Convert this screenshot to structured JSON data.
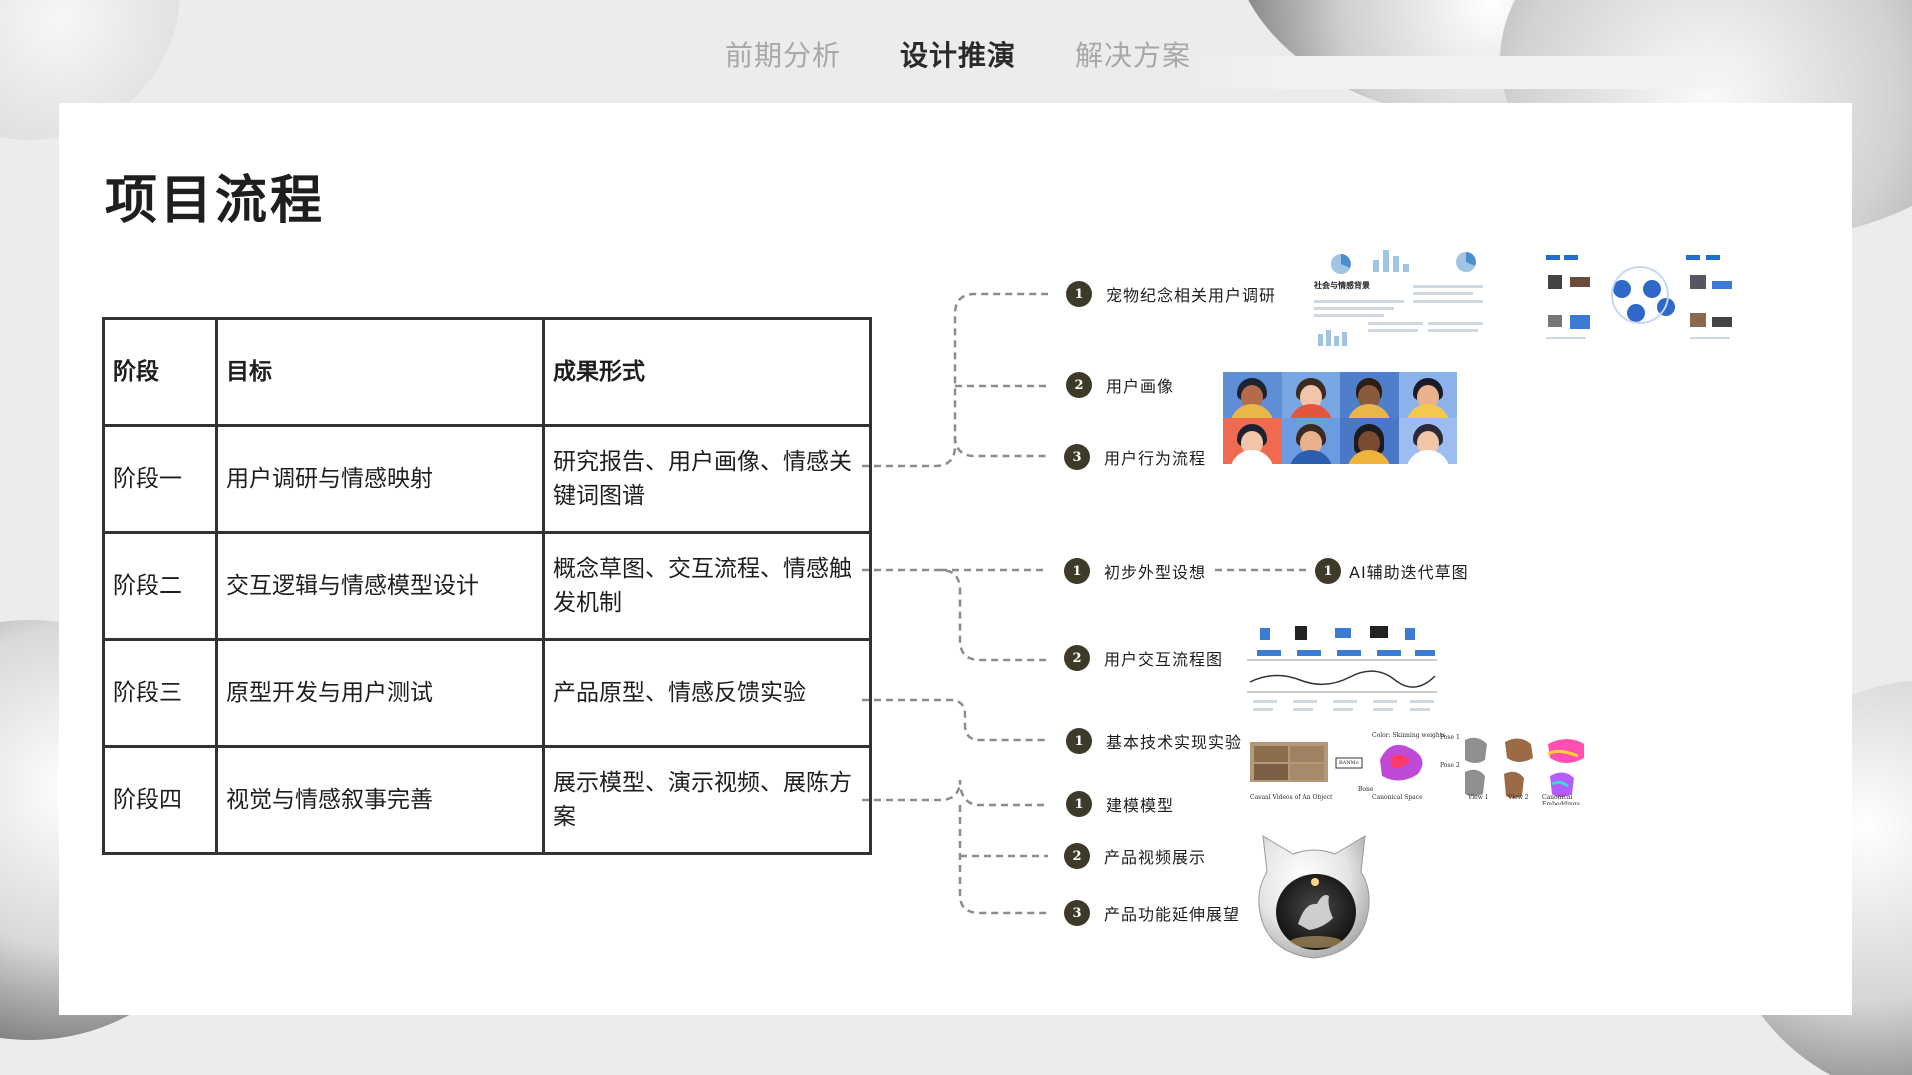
{
  "nav": {
    "tabs": [
      {
        "label": "前期分析",
        "active": false
      },
      {
        "label": "设计推演",
        "active": true
      },
      {
        "label": "解决方案",
        "active": false
      }
    ]
  },
  "page": {
    "title": "项目流程"
  },
  "table": {
    "headers": [
      "阶段",
      "目标",
      "成果形式"
    ],
    "rows": [
      [
        "阶段一",
        "用户调研与情感映射",
        "研究报告、用户画像、情感关键词图谱"
      ],
      [
        "阶段二",
        "交互逻辑与情感模型设计",
        "概念草图、交互流程、情感触发机制"
      ],
      [
        "阶段三",
        "原型开发与用户测试",
        "产品原型、情感反馈实验"
      ],
      [
        "阶段四",
        "视觉与情感叙事完善",
        "展示模型、演示视频、展陈方案"
      ]
    ]
  },
  "branches": {
    "stage1": [
      {
        "num": "1",
        "label": "宠物纪念相关用户调研"
      },
      {
        "num": "2",
        "label": "用户画像"
      },
      {
        "num": "3",
        "label": "用户行为流程"
      }
    ],
    "stage2": [
      {
        "num": "1",
        "label": "初步外型设想"
      },
      {
        "num": "1",
        "label": "AI辅助迭代草图"
      },
      {
        "num": "2",
        "label": "用户交互流程图"
      }
    ],
    "stage3": [
      {
        "num": "1",
        "label": "基本技术实现实验"
      }
    ],
    "stage4": [
      {
        "num": "1",
        "label": "建模模型"
      },
      {
        "num": "2",
        "label": "产品视频展示"
      },
      {
        "num": "3",
        "label": "产品功能延伸展望"
      }
    ]
  },
  "thumbnails": {
    "research_doc_heading": "社会与情感背景",
    "tech_caption_left": "Casual Videos of An Object",
    "tech_caption_mid": "Canonical Space",
    "tech_caption_v1": "View 1",
    "tech_caption_v2": "View 2",
    "tech_caption_right": "Canonical Embeddings",
    "tech_top_label": "Color: Skinning weights",
    "tech_pose1": "Pose 1",
    "tech_pose2": "Pose 2",
    "tech_bone": "Bone",
    "tech_banmo": "BANMo"
  },
  "colors": {
    "node_bg": "#3d3a2a",
    "line": "#8c8c8c",
    "border": "#333333"
  }
}
